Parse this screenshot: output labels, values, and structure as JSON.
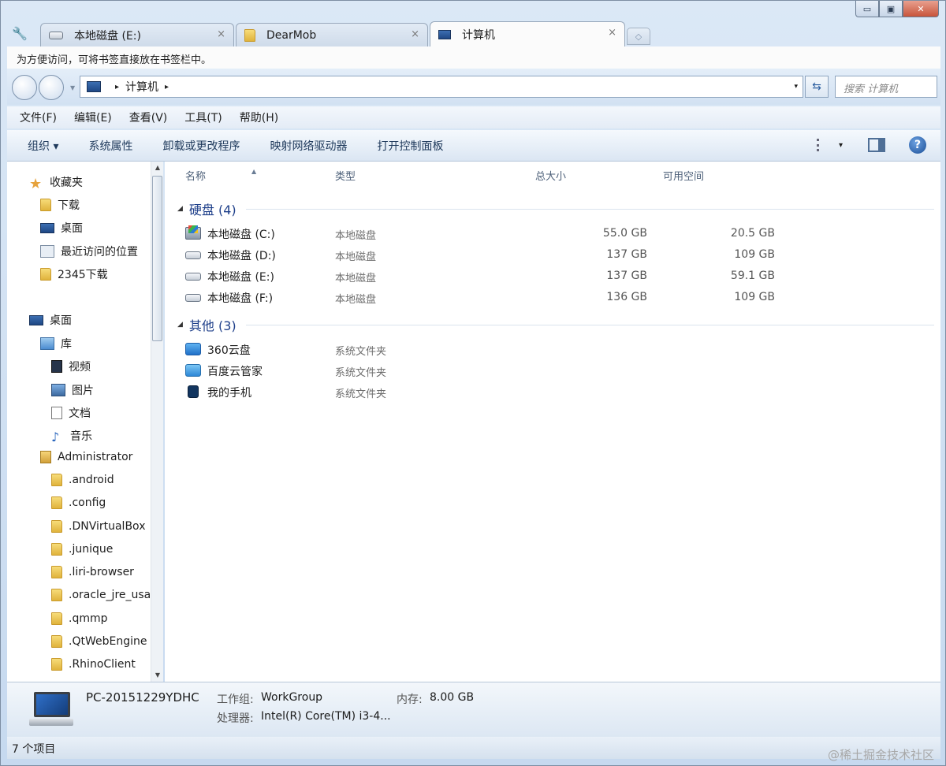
{
  "window": {
    "caption_min": "▭",
    "caption_max": "▣",
    "caption_close": "✕"
  },
  "tabs": [
    {
      "label": "本地磁盘 (E:)",
      "close": "×",
      "icon": "drive-icon"
    },
    {
      "label": "DearMob",
      "close": "×",
      "icon": "folder-icon"
    },
    {
      "label": "计算机",
      "close": "×",
      "icon": "computer-icon"
    }
  ],
  "new_tab": "◇",
  "bookmark_bar": {
    "text": "为方便访问，可将书签直接放在书签栏中。"
  },
  "address": {
    "crumb_arrow": "▸",
    "crumb": "计算机",
    "crumb_arrow2": "▸",
    "dropdown": "▾",
    "refresh": "⇆",
    "search_placeholder": "搜索 计算机"
  },
  "menu": [
    "文件(F)",
    "编辑(E)",
    "查看(V)",
    "工具(T)",
    "帮助(H)"
  ],
  "commands": [
    "组织 ▾",
    "系统属性",
    "卸载或更改程序",
    "映射网络驱动器",
    "打开控制面板"
  ],
  "cmd_right": {
    "view_dd": "▾",
    "help": "?"
  },
  "nav": {
    "favorites": "收藏夹",
    "downloads": "下载",
    "desktop_fav": "桌面",
    "recent": "最近访问的位置",
    "dl2345": "2345下载",
    "desktop": "桌面",
    "library": "库",
    "video": "视频",
    "pictures": "图片",
    "documents": "文档",
    "music": "音乐",
    "admin": "Administrator",
    "folders": [
      ".android",
      ".config",
      ".DNVirtualBox",
      ".junique",
      ".liri-browser",
      ".oracle_jre_usage",
      ".qmmp",
      ".QtWebEngine",
      ".RhinoClient"
    ]
  },
  "scroll": {
    "up": "▲",
    "down": "▼"
  },
  "columns": {
    "name": "名称",
    "type": "类型",
    "total": "总大小",
    "free": "可用空间",
    "sort": "▲"
  },
  "groups": {
    "disks": {
      "label": "硬盘 (4)",
      "tri": "◢"
    },
    "other": {
      "label": "其他 (3)",
      "tri": "◢"
    }
  },
  "drives": [
    {
      "name": "本地磁盘 (C:)",
      "type": "本地磁盘",
      "total": "55.0 GB",
      "free": "20.5 GB"
    },
    {
      "name": "本地磁盘 (D:)",
      "type": "本地磁盘",
      "total": "137 GB",
      "free": "109 GB"
    },
    {
      "name": "本地磁盘 (E:)",
      "type": "本地磁盘",
      "total": "137 GB",
      "free": "59.1 GB"
    },
    {
      "name": "本地磁盘 (F:)",
      "type": "本地磁盘",
      "total": "136 GB",
      "free": "109 GB"
    }
  ],
  "others": [
    {
      "name": "360云盘",
      "type": "系统文件夹"
    },
    {
      "name": "百度云管家",
      "type": "系统文件夹"
    },
    {
      "name": "我的手机",
      "type": "系统文件夹"
    }
  ],
  "details": {
    "pc_name": "PC-20151229YDHC",
    "workgroup_label": "工作组:",
    "workgroup": "WorkGroup",
    "memory_label": "内存:",
    "memory": "8.00 GB",
    "cpu_label": "处理器:",
    "cpu": "Intel(R) Core(TM) i3-4..."
  },
  "status": {
    "items": "7 个项目"
  },
  "watermark": "@稀土掘金技术社区",
  "colors": {
    "accent": "#1e3f8a",
    "frame": "#cfdff1",
    "close": "#c8543b"
  }
}
